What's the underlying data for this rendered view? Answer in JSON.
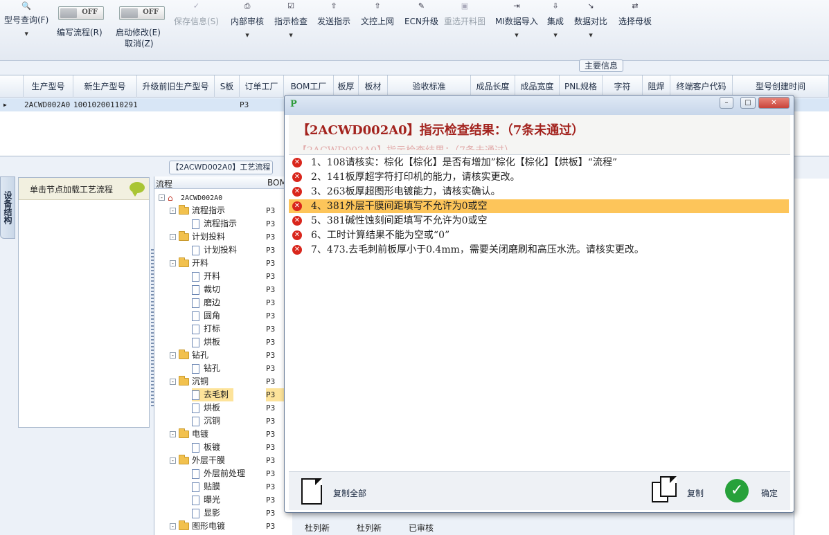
{
  "toolbar": {
    "query_label": "型号查询(F)",
    "edit_flow_label": "编写流程(R)",
    "enable_edit_label": "启动修改(E)",
    "cancel_label": "取消(Z)",
    "toggle_off": "OFF",
    "save_label": "保存信息(S)",
    "internal_review_label": "内部审核",
    "instruction_check_label": "指示检查",
    "send_instruction_label": "发送指示",
    "doc_online_label": "文控上网",
    "ecn_upgrade_label": "ECN升级",
    "reselect_image_label": "重选开料图",
    "mi_import_label": "MI数据导入",
    "integrate_label": "集成",
    "compare_label": "数据对比",
    "select_mother_label": "选择母板"
  },
  "main_info_badge": "主要信息",
  "grid": {
    "columns": [
      "生产型号",
      "新生产型号",
      "升级前旧生产型号",
      "S板",
      "订单工厂",
      "BOM工厂",
      "板厚",
      "板材",
      "验收标准",
      "成品长度",
      "成品宽度",
      "PNL规格",
      "字符",
      "阻焊",
      "终端客户代码",
      "型号创建时间"
    ],
    "row": {
      "model": "2ACWD002A0",
      "new_model": "10010200110291",
      "factory": "P3"
    }
  },
  "process_badge": "【2ACWD002A0】工艺流程",
  "side_tab": "设备结构",
  "left_panel_text": "单击节点加载工艺流程",
  "tree": {
    "col_flow": "流程",
    "col_bom": "BOM",
    "root": "2ACWD002A0",
    "nodes": [
      "流程指示",
      "流程指示",
      "计划投料",
      "计划投料",
      "开料",
      "开料",
      "裁切",
      "磨边",
      "圆角",
      "打标",
      "烘板",
      "钻孔",
      "钻孔",
      "沉铜",
      "去毛刺",
      "烘板",
      "沉铜",
      "电镀",
      "板镀",
      "外层干膜",
      "外层前处理",
      "贴膜",
      "曝光",
      "显影",
      "图形电镀"
    ],
    "p3": "P3"
  },
  "bg_cells": {
    "c1": "杜列新",
    "c2": "杜列新",
    "c3": "已审核"
  },
  "dialog": {
    "title": "【2ACWD002A0】指示检查结果：（7条未通过）",
    "ghost": "【2ACWD002A0】指示检查结果：（7条未通过）",
    "items": [
      "1、108请核实：棕化【棕化】是否有增加”棕化【棕化】【烘板】“流程”",
      "2、141板厚超字符打印机的能力，请核实更改。",
      "3、263板厚超图形电镀能力，请核实确认。",
      "4、381外层干膜间距填写不允许为0或空",
      "5、381碱性蚀刻间距填写不允许为0或空",
      "6、工时计算结果不能为空或“0”",
      "7、473.去毛刺前板厚小于0.4mm，需要关闭磨刷和高压水洗。请核实更改。"
    ],
    "copy_all": "复制全部",
    "copy": "复制",
    "ok": "确定"
  },
  "colors": {
    "title_red": "#a3231e",
    "selection": "#fdc55a",
    "error_icon": "#d9261c",
    "ok_green": "#27a13a"
  }
}
